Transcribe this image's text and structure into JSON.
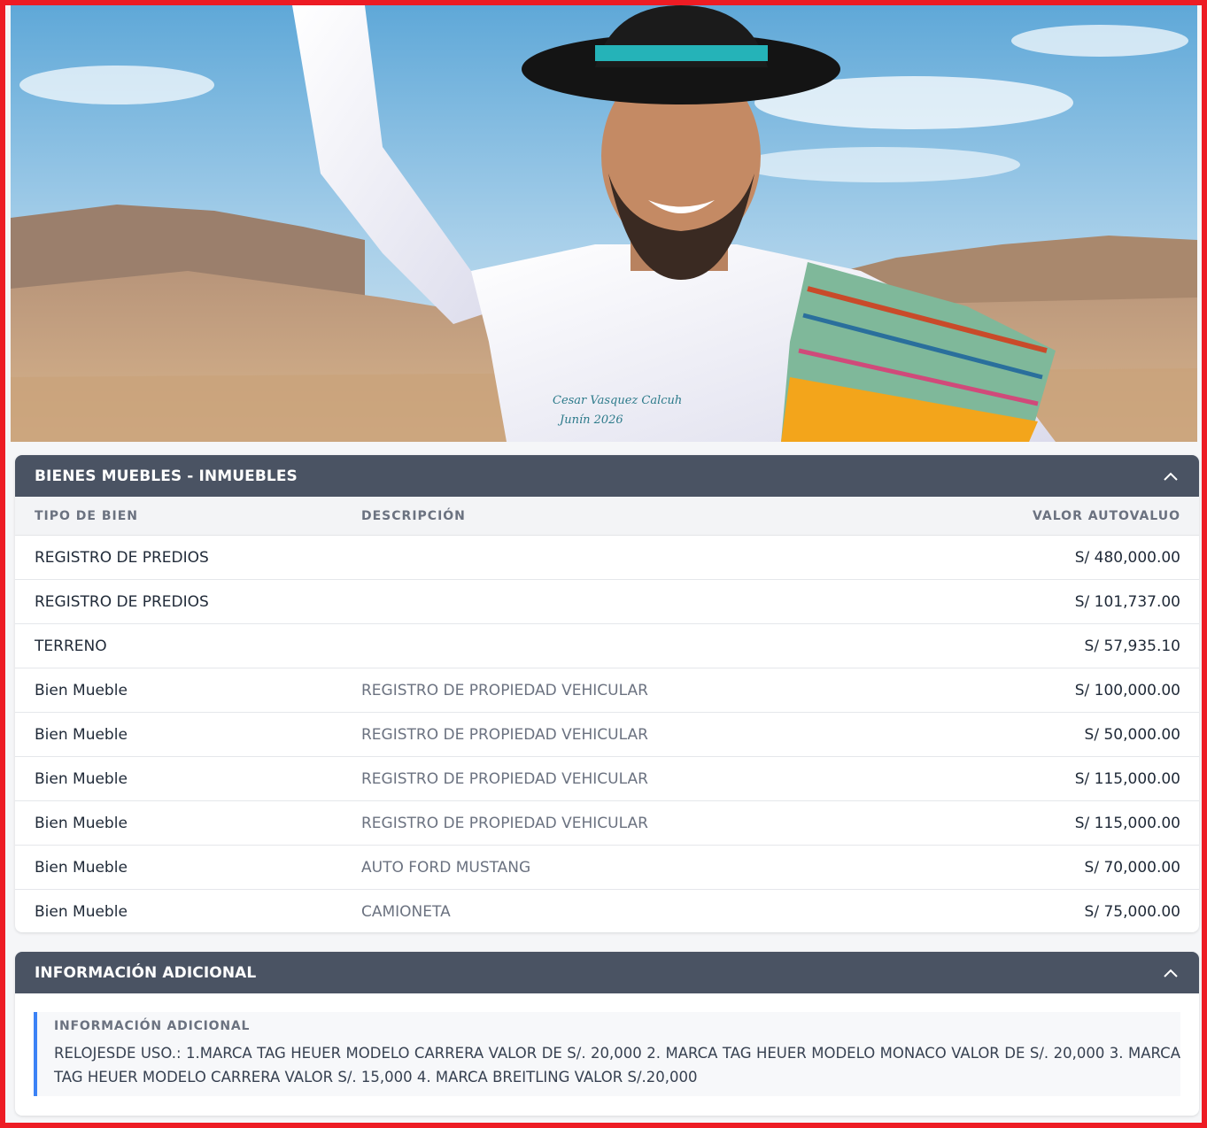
{
  "photo": {
    "description_icon": "candidate-photo",
    "shirt_embroidery": [
      "Cesar Vasquez Calcuh",
      "Junín 2026"
    ]
  },
  "assets": {
    "section_title": "BIENES MUEBLES - INMUEBLES",
    "columns": {
      "type": "TIPO DE BIEN",
      "description": "DESCRIPCIÓN",
      "value": "VALOR AUTOVALUO"
    },
    "rows": [
      {
        "type": "REGISTRO DE PREDIOS",
        "description": "",
        "value": "S/ 480,000.00"
      },
      {
        "type": "REGISTRO DE PREDIOS",
        "description": "",
        "value": "S/ 101,737.00"
      },
      {
        "type": "TERRENO",
        "description": "",
        "value": "S/ 57,935.10"
      },
      {
        "type": "Bien Mueble",
        "description": "REGISTRO DE PROPIEDAD VEHICULAR",
        "value": "S/ 100,000.00"
      },
      {
        "type": "Bien Mueble",
        "description": "REGISTRO DE PROPIEDAD VEHICULAR",
        "value": "S/ 50,000.00"
      },
      {
        "type": "Bien Mueble",
        "description": "REGISTRO DE PROPIEDAD VEHICULAR",
        "value": "S/ 115,000.00"
      },
      {
        "type": "Bien Mueble",
        "description": "REGISTRO DE PROPIEDAD VEHICULAR",
        "value": "S/ 115,000.00"
      },
      {
        "type": "Bien Mueble",
        "description": "AUTO FORD MUSTANG",
        "value": "S/ 70,000.00"
      },
      {
        "type": "Bien Mueble",
        "description": "CAMIONETA",
        "value": "S/ 75,000.00"
      }
    ]
  },
  "additional": {
    "section_title": "INFORMACIÓN ADICIONAL",
    "box_label": "INFORMACIÓN ADICIONAL",
    "text": "RELOJESDE USO.: 1.MARCA TAG HEUER MODELO CARRERA VALOR DE S/. 20,000 2. MARCA TAG HEUER MODELO MONACO VALOR DE S/. 20,000 3. MARCA TAG HEUER MODELO CARRERA VALOR S/. 15,000 4. MARCA BREITLING VALOR S/.20,000"
  },
  "colors": {
    "frame": "#ed1c24",
    "header_bg": "#4a5363",
    "accent": "#3b82f6"
  }
}
